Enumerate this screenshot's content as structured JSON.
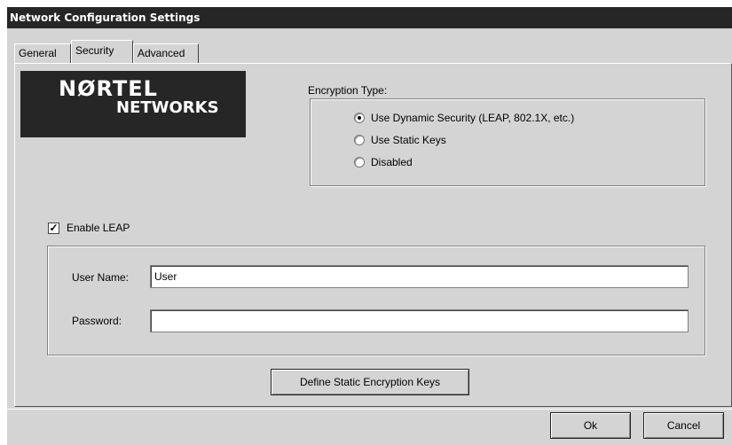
{
  "window": {
    "title": "Network Configuration Settings"
  },
  "tabs": [
    {
      "label": "General",
      "selected": false
    },
    {
      "label": "Security",
      "selected": true
    },
    {
      "label": "Advanced",
      "selected": false
    }
  ],
  "logo": {
    "line1": "NØRTEL",
    "line2": "NETWORKS"
  },
  "encryption": {
    "heading": "Encryption Type:",
    "options": [
      {
        "label": "Use Dynamic Security (LEAP, 802.1X, etc.)",
        "selected": true
      },
      {
        "label": "Use Static Keys",
        "selected": false
      },
      {
        "label": "Disabled",
        "selected": false
      }
    ]
  },
  "leap": {
    "enable_label": "Enable LEAP",
    "enabled": true,
    "username_label": "User Name:",
    "username_value": "User",
    "password_label": "Password:",
    "password_value": ""
  },
  "buttons": {
    "define_keys": "Define Static Encryption Keys",
    "ok": "Ok",
    "cancel": "Cancel"
  }
}
